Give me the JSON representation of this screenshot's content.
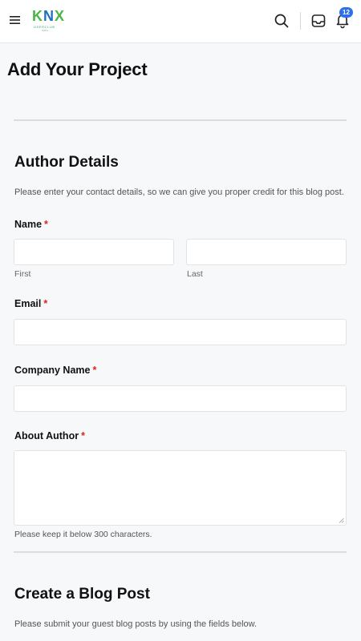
{
  "header": {
    "logo_text_k": "K",
    "logo_text_n": "N",
    "logo_text_x": "X",
    "logo_sub": "USERCLUB",
    "logo_sub2": "INDIA",
    "notification_count": "12",
    "icons": [
      "menu-icon",
      "search-icon",
      "inbox-icon",
      "bell-icon"
    ]
  },
  "page": {
    "title": "Add Your Project"
  },
  "author_section": {
    "title": "Author Details",
    "description": "Please enter your contact details, so we can give you proper credit for this blog post.",
    "name_label": "Name",
    "first_sublabel": "First",
    "last_sublabel": "Last",
    "email_label": "Email",
    "company_label": "Company Name",
    "about_label": "About Author",
    "about_hint": "Please keep it below 300 characters.",
    "required_mark": "*"
  },
  "blog_section": {
    "title": "Create a Blog Post",
    "description": "Please submit your guest blog posts by using the fields below."
  },
  "colors": {
    "accent_blue": "#2f6fed",
    "required_red": "#dd2222",
    "logo_blue": "#1e6fbf",
    "logo_green": "#4bb543"
  }
}
